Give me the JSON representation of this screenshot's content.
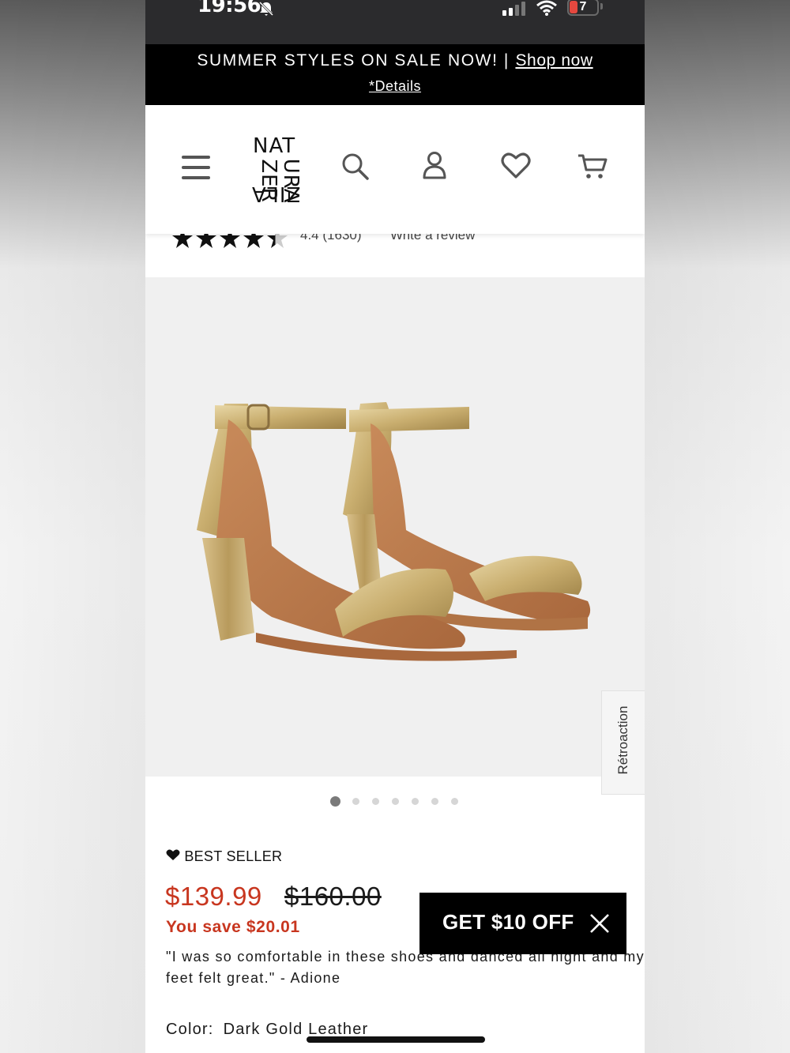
{
  "status_bar": {
    "time": "19:56",
    "battery": "7"
  },
  "promo_banner": {
    "message": "SUMMER STYLES ON SALE NOW! | ",
    "link": "Shop now",
    "details": "*Details"
  },
  "header": {
    "logo": {
      "top": "NAT",
      "left": "ZER",
      "right": "URA",
      "bottom": "ZILA"
    },
    "icons": [
      "menu-icon",
      "search-icon",
      "account-icon",
      "heart-icon",
      "cart-icon"
    ]
  },
  "rating": {
    "score": "4.4",
    "count": "(1630)",
    "write_review": "Write a review",
    "stars": 4.4
  },
  "gallery": {
    "total_images": 7,
    "active_index": 0,
    "feedback_tab": "Rétroaction"
  },
  "product": {
    "badge": "BEST SELLER",
    "price": "$139.99",
    "original_price": "$160.00",
    "savings": "You save $20.01",
    "quote": "\"I was so comfortable in these shoes and danced all night and my feet felt great.\" - Adione",
    "color_label": "Color:",
    "color_value": "Dark Gold Leather"
  },
  "popup": {
    "label": "GET $10 OFF"
  },
  "colors": {
    "sale_red": "#c8361f",
    "banner_black": "#000000",
    "gold": "#c9ae6f"
  }
}
